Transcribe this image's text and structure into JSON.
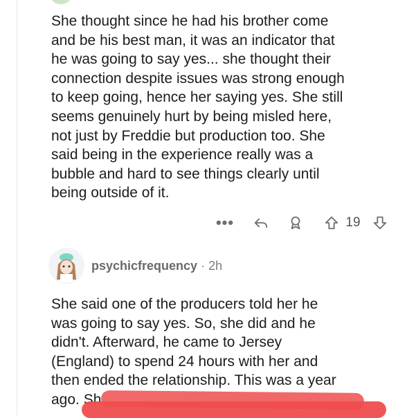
{
  "comment1": {
    "text": "She thought since he had his brother come\nand be his best man, it was an indicator that\nhe was going to say yes... she thought their\nconnection despite issues was strong enough\nto keep going, hence her saying yes.  She still\nseems genuinely hurt by being misled here,\nnot just by Freddie but production too.  She\nsaid being in the experience really was a\nbubble and hard to see things clearly until\nbeing outside of it.",
    "more_label": "•••",
    "vote_count": "19"
  },
  "comment2": {
    "username": "psychicfrequency",
    "separator": "·",
    "time": "2h",
    "text": "She said one of the producers told her he\nwas going to say yes. So, she did and he\ndidn't. Afterward, he came to Jersey\n(England) to spend 24 hours with her and\nthen ended the relationship. This was a year\nago. Sh"
  },
  "colors": {
    "redaction": "#ef4d4d",
    "icon_gray": "#6a6f73"
  },
  "icons": [
    "more-options-icon",
    "reply-icon",
    "award-icon",
    "upvote-icon",
    "downvote-icon"
  ]
}
